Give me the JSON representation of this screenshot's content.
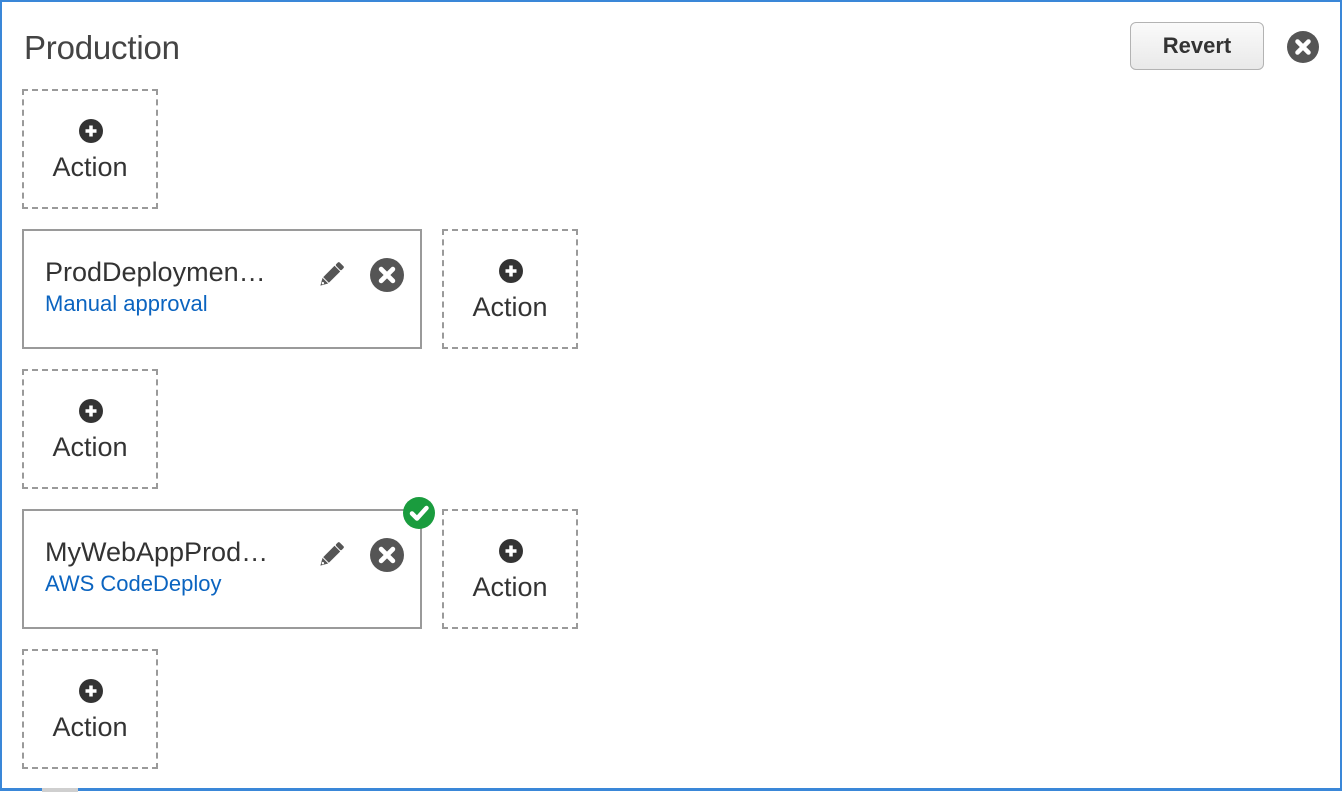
{
  "stage": {
    "title": "Production",
    "revert_label": "Revert",
    "close_icon": "close-circle-icon"
  },
  "add_action_label": "Action",
  "add_action_icon": "plus-circle-icon",
  "action_groups": [
    {
      "add_label": "Action"
    },
    {
      "action": {
        "name": "ProdDeploymen…",
        "provider": "Manual approval",
        "edit_icon": "pencil-icon",
        "remove_icon": "close-circle-icon",
        "status": null
      },
      "side_add_label": "Action"
    },
    {
      "add_label": "Action"
    },
    {
      "action": {
        "name": "MyWebAppProd…",
        "provider": "AWS CodeDeploy",
        "edit_icon": "pencil-icon",
        "remove_icon": "close-circle-icon",
        "status": "success"
      },
      "side_add_label": "Action"
    },
    {
      "add_label": "Action"
    }
  ],
  "colors": {
    "accent_border": "#3a87d8",
    "link": "#0b64c0",
    "success": "#1a9c3e",
    "icon_dark": "#555555"
  }
}
